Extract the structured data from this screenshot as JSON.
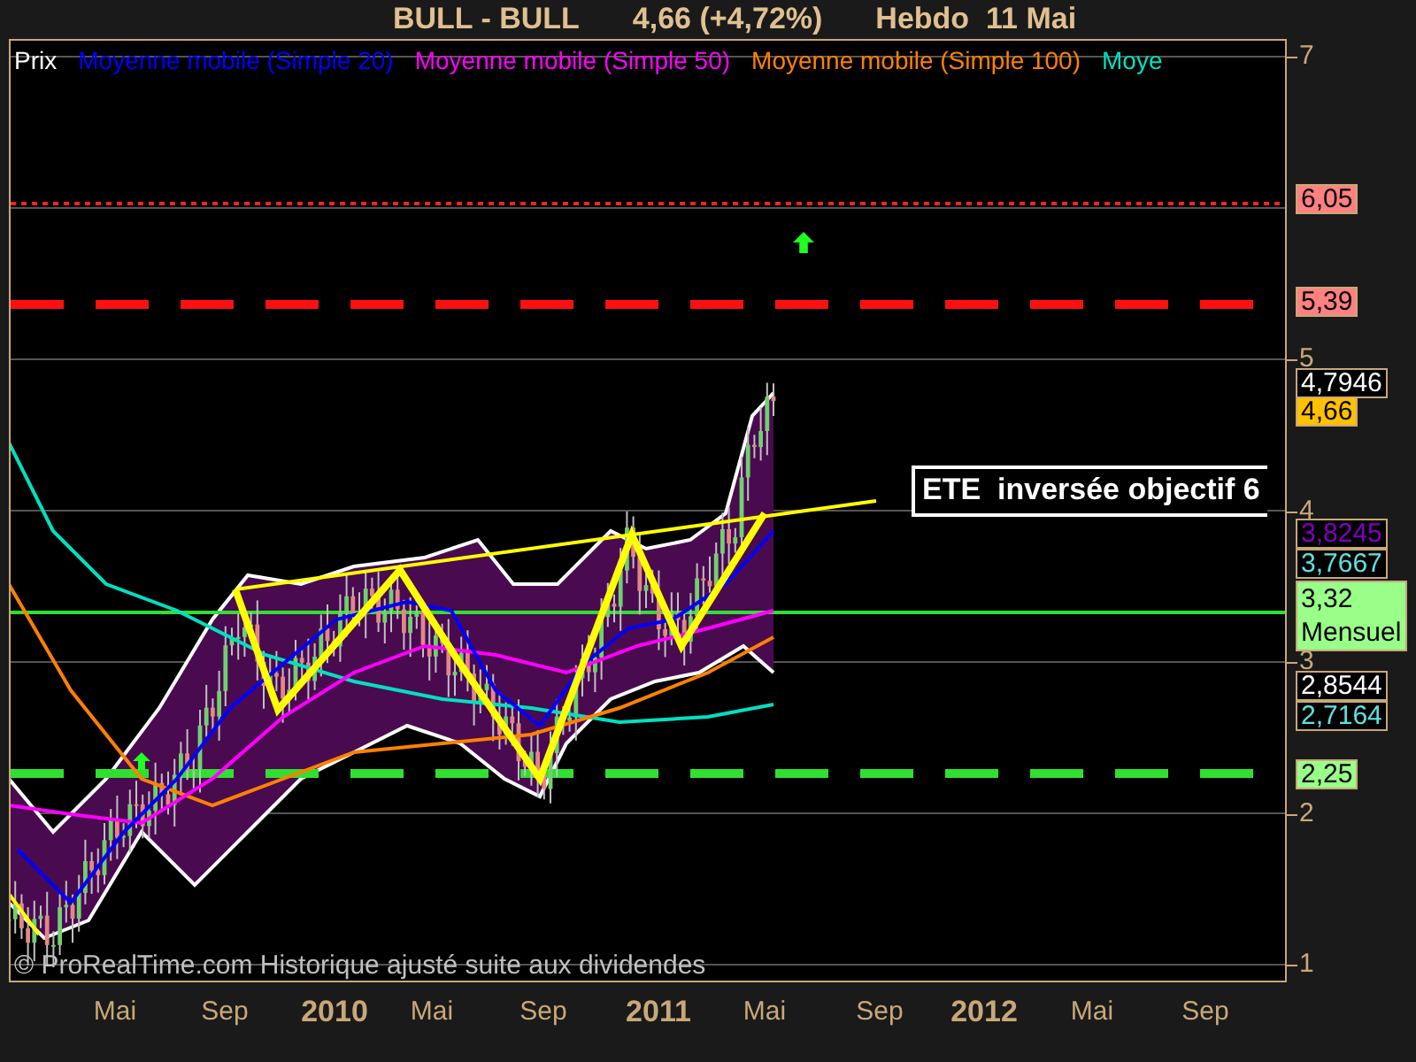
{
  "title": {
    "symbol": "BULL - BULL",
    "quote": "4,66 (+4,72%)",
    "period": "Hebdo  11 Mai"
  },
  "legend": [
    {
      "label": "Prix",
      "color": "#ffffff"
    },
    {
      "label": "Moyenne mobile (Simple 20)",
      "color": "#0000ff"
    },
    {
      "label": "Moyenne mobile (Simple 50)",
      "color": "#ff00ff"
    },
    {
      "label": "Moyenne mobile (Simple 100)",
      "color": "#ff8000"
    },
    {
      "label": "Moye",
      "color": "#00e0c0"
    }
  ],
  "annotation": "ETE  inversée objectif 6",
  "y_ticks": [
    "7",
    "5",
    "4",
    "3",
    "2",
    "1"
  ],
  "price_labels": [
    {
      "text": "6,05",
      "kind": "filled",
      "color": "#ff8080"
    },
    {
      "text": "5,39",
      "kind": "filled",
      "color": "#ff8080"
    },
    {
      "text": "4,7946",
      "kind": "outlined",
      "color": "#ffffff"
    },
    {
      "text": "4,66",
      "kind": "filled",
      "color": "#ffc000"
    },
    {
      "text": "3,8245",
      "kind": "outlined",
      "color": "#8000c0"
    },
    {
      "text": "3,7667",
      "kind": "outlined",
      "color": "#60e0e0"
    },
    {
      "text": "3,32",
      "sub": "Mensuel",
      "kind": "filled",
      "color": "#99ff88"
    },
    {
      "text": "2,8544",
      "kind": "outlined",
      "color": "#ffffff"
    },
    {
      "text": "2,7164",
      "kind": "outlined",
      "color": "#60e0e0"
    },
    {
      "text": "2,25",
      "kind": "filled",
      "color": "#99ff88"
    }
  ],
  "x_labels": [
    {
      "label": "Mai",
      "kind": "month"
    },
    {
      "label": "Sep",
      "kind": "month"
    },
    {
      "label": "2010",
      "kind": "year"
    },
    {
      "label": "Mai",
      "kind": "month"
    },
    {
      "label": "Sep",
      "kind": "month"
    },
    {
      "label": "2011",
      "kind": "year"
    },
    {
      "label": "Mai",
      "kind": "month"
    },
    {
      "label": "Sep",
      "kind": "month"
    },
    {
      "label": "2012",
      "kind": "year"
    },
    {
      "label": "Mai",
      "kind": "month"
    },
    {
      "label": "Sep",
      "kind": "month"
    }
  ],
  "footer": "© ProRealTime.com Historique ajusté suite aux dividendes"
}
